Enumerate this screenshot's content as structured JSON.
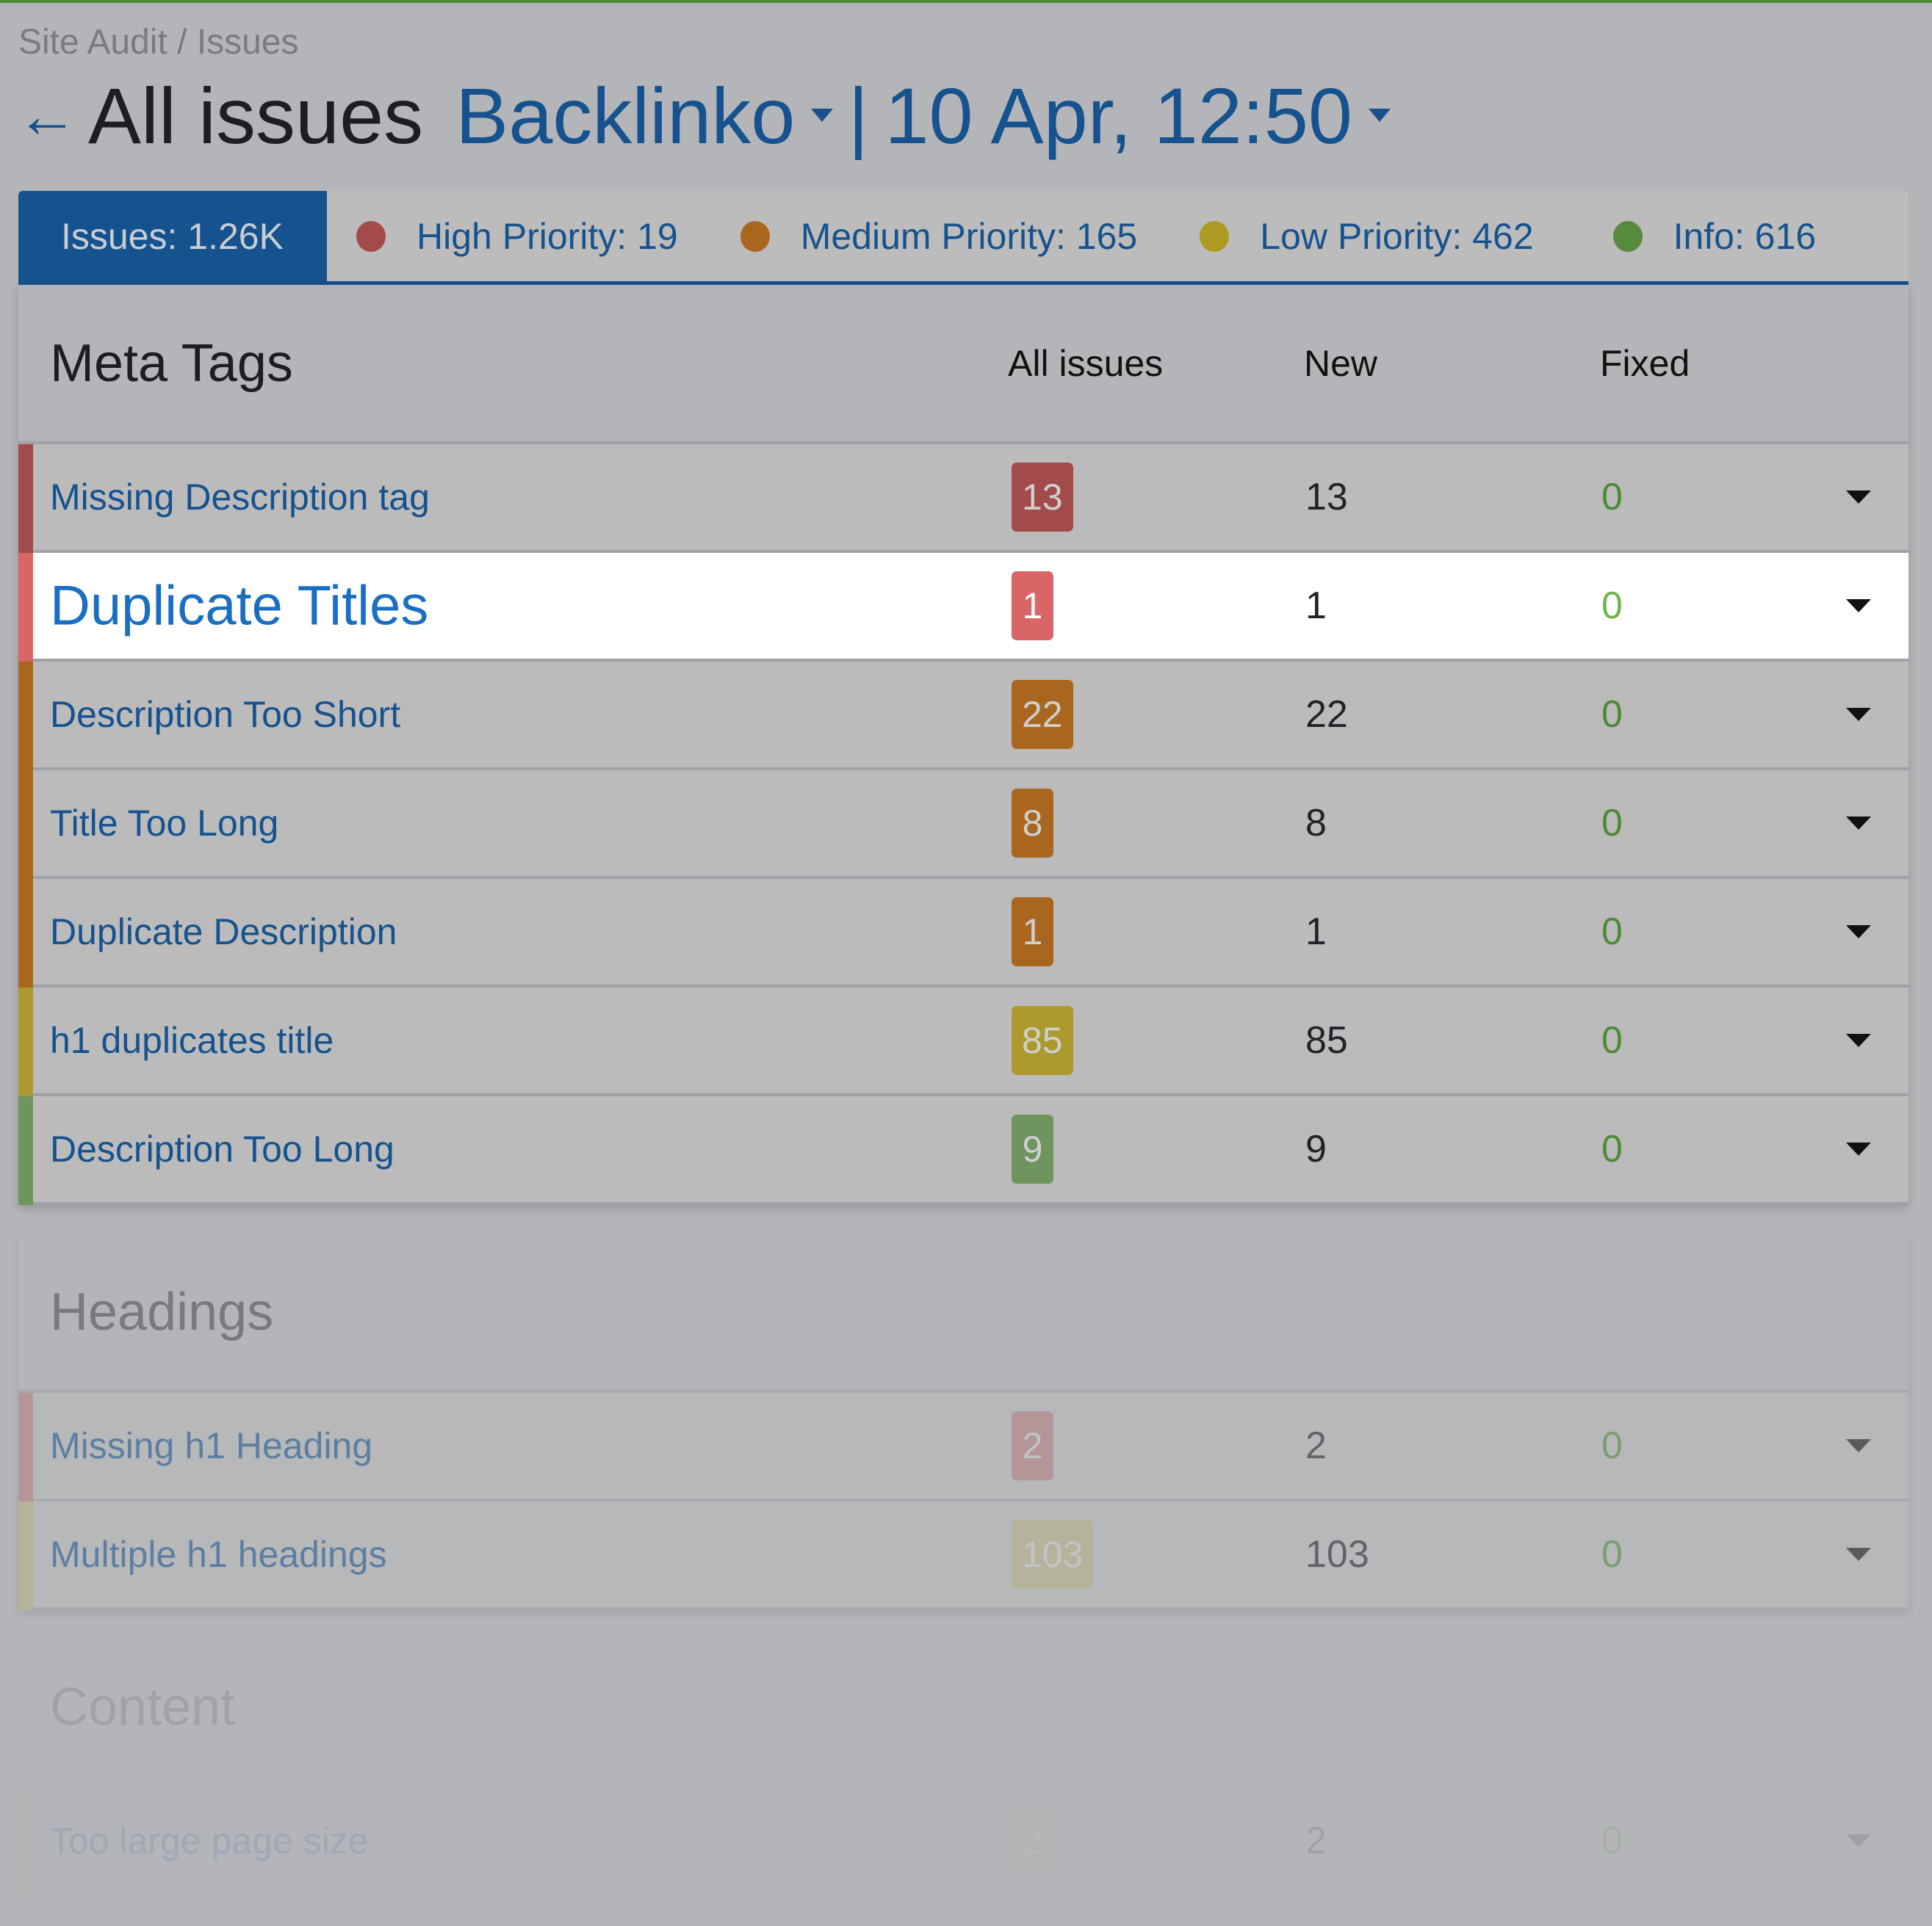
{
  "breadcrumb": "Site Audit / Issues",
  "header": {
    "back_icon": "arrow-left-icon",
    "title": "All issues",
    "project": "Backlinko",
    "separator": "|",
    "date": "10 Apr, 12:50"
  },
  "tabs": [
    {
      "label": "Issues: 1.26K",
      "active": true
    },
    {
      "label": "High Priority: 19",
      "dot_color": "#a34a4b"
    },
    {
      "label": "Medium Priority: 165",
      "dot_color": "#a9661f"
    },
    {
      "label": "Low Priority: 462",
      "dot_color": "#ac9a22"
    },
    {
      "label": "Info: 616",
      "dot_color": "#568a3c"
    }
  ],
  "columns": {
    "all_issues": "All issues",
    "new": "New",
    "fixed": "Fixed"
  },
  "sections": [
    {
      "title": "Meta Tags",
      "rows": [
        {
          "name": "Missing Description tag",
          "all": "13",
          "new": "13",
          "fixed": "0",
          "priority": "high",
          "color": "#a34a4b"
        },
        {
          "name": "Duplicate Titles",
          "all": "1",
          "new": "1",
          "fixed": "0",
          "priority": "high",
          "color": "#d96566",
          "highlighted": true
        },
        {
          "name": "Description Too Short",
          "all": "22",
          "new": "22",
          "fixed": "0",
          "priority": "medium",
          "color": "#a9661f"
        },
        {
          "name": "Title Too Long",
          "all": "8",
          "new": "8",
          "fixed": "0",
          "priority": "medium",
          "color": "#a9661f"
        },
        {
          "name": "Duplicate Description",
          "all": "1",
          "new": "1",
          "fixed": "0",
          "priority": "medium",
          "color": "#a9661f"
        },
        {
          "name": "h1 duplicates title",
          "all": "85",
          "new": "85",
          "fixed": "0",
          "priority": "low",
          "color": "#ac9a2e"
        },
        {
          "name": "Description Too Long",
          "all": "9",
          "new": "9",
          "fixed": "0",
          "priority": "info",
          "color": "#6f945e"
        }
      ]
    },
    {
      "title": "Headings",
      "rows": [
        {
          "name": "Missing h1 Heading",
          "all": "2",
          "new": "2",
          "fixed": "0",
          "priority": "high",
          "color": "#b77d7e"
        },
        {
          "name": "Multiple h1 headings",
          "all": "103",
          "new": "103",
          "fixed": "0",
          "priority": "low",
          "color": "#b6b386"
        }
      ]
    },
    {
      "title": "Content",
      "rows": [
        {
          "name": "Too large page size",
          "all": "2",
          "new": "2",
          "fixed": "0",
          "priority": "high",
          "color": "#b8b2b0"
        }
      ]
    }
  ]
}
